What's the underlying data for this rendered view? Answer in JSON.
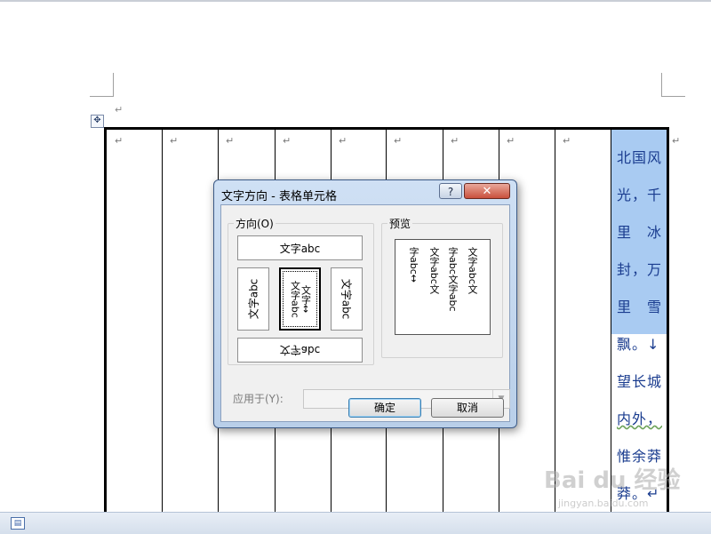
{
  "document": {
    "paragraph_mark": "↵",
    "move_handle_glyph": "✥",
    "cell_text_lines": [
      "北国风",
      "光，千",
      "里　冰",
      "封，万",
      "里　雪",
      "飘。↓",
      "望长城",
      "内外，",
      "惟余莽",
      "莽。↵"
    ]
  },
  "dialog": {
    "title": "文字方向 - 表格单元格",
    "help_label": "?",
    "close_label": "✕",
    "direction_group_label": "方向(O)",
    "options": {
      "horizontal": "文字abc",
      "rotate_left": "文字abc",
      "vertical_stack_col1": "文字↔",
      "vertical_stack_col2": "文字abc",
      "rotate_right": "文字abc",
      "upside_down": "文字abc"
    },
    "preview_group_label": "预览",
    "preview_columns": [
      "文字abc文",
      "字abc文字abc",
      "文字abc文",
      "字abc↔"
    ],
    "apply_label": "应用于(Y):",
    "apply_value": "",
    "ok_label": "确定",
    "cancel_label": "取消"
  },
  "watermark": {
    "brand": "Bai du 经验",
    "url": "jingyan.baidu.com"
  },
  "statusbar": {
    "icon": "document-view-icon"
  }
}
